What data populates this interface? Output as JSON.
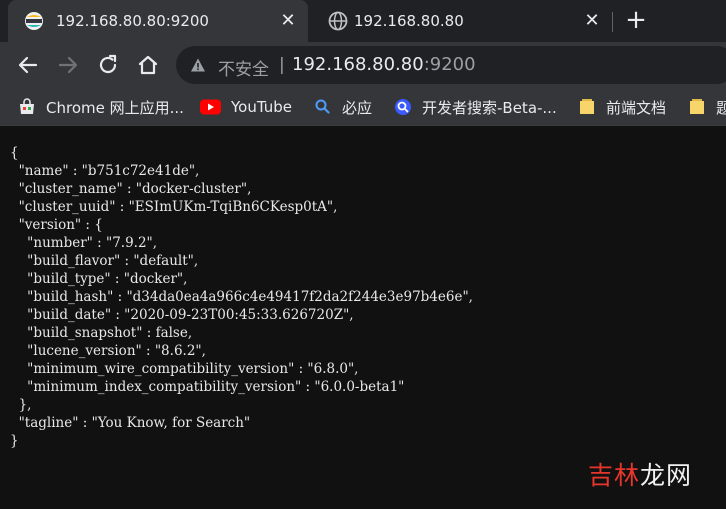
{
  "tabs": [
    {
      "title": "192.168.80.80:9200",
      "favicon": "elastic-icon",
      "active": true
    },
    {
      "title": "192.168.80.80",
      "favicon": "globe-icon",
      "active": false
    }
  ],
  "toolbar": {
    "security_label": "不安全",
    "separator": "|",
    "url_host": "192.168.80.80",
    "url_port": ":9200"
  },
  "bookmarks": [
    {
      "label": "Chrome 网上应用...",
      "icon": "chrome-store-icon"
    },
    {
      "label": "YouTube",
      "icon": "youtube-icon"
    },
    {
      "label": "必应",
      "icon": "search-icon"
    },
    {
      "label": "开发者搜索-Beta-...",
      "icon": "developer-search-icon"
    },
    {
      "label": "前端文档",
      "icon": "folder-icon"
    },
    {
      "label": "题",
      "icon": "folder-icon"
    }
  ],
  "json_response": "{\n  \"name\" : \"b751c72e41de\",\n  \"cluster_name\" : \"docker-cluster\",\n  \"cluster_uuid\" : \"ESImUKm-TqiBn6CKesp0tA\",\n  \"version\" : {\n    \"number\" : \"7.9.2\",\n    \"build_flavor\" : \"default\",\n    \"build_type\" : \"docker\",\n    \"build_hash\" : \"d34da0ea4a966c4e49417f2da2f244e3e97b4e6e\",\n    \"build_date\" : \"2020-09-23T00:45:33.626720Z\",\n    \"build_snapshot\" : false,\n    \"lucene_version\" : \"8.6.2\",\n    \"minimum_wire_compatibility_version\" : \"6.8.0\",\n    \"minimum_index_compatibility_version\" : \"6.0.0-beta1\"\n  },\n  \"tagline\" : \"You Know, for Search\"\n}",
  "watermark": {
    "part1": "吉林",
    "part2": "龙网"
  }
}
